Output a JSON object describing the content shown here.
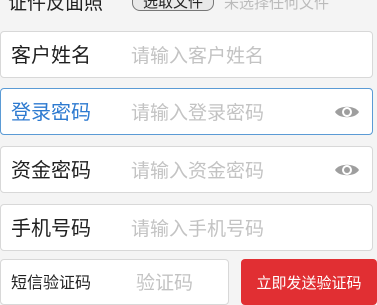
{
  "top_row": {
    "label": "证件反面照",
    "file_button_label": "选取文件",
    "faint_text": "未选择任何文件"
  },
  "fields": [
    {
      "name": "customer-name",
      "label": "客户姓名",
      "placeholder": "请输入客户姓名",
      "value": "",
      "active": false,
      "has_eye": false
    },
    {
      "name": "login-password",
      "label": "登录密码",
      "placeholder": "请输入登录密码",
      "value": "",
      "active": true,
      "has_eye": true,
      "icon": "eye-icon"
    },
    {
      "name": "fund-password",
      "label": "资金密码",
      "placeholder": "请输入资金密码",
      "value": "",
      "active": false,
      "has_eye": true,
      "icon": "eye-icon"
    },
    {
      "name": "phone-number",
      "label": "手机号码",
      "placeholder": "请输入手机号码",
      "value": "",
      "active": false,
      "has_eye": false
    }
  ],
  "sms": {
    "label": "短信验证码",
    "placeholder": "验证码",
    "value": "",
    "button_label": "立即发送验证码",
    "button_color": "#e12f33"
  },
  "colors": {
    "active_border": "#5b9bd5",
    "active_label": "#2d7ad0",
    "placeholder": "#c3c3c3",
    "eye_icon": "#9e9e9e"
  }
}
